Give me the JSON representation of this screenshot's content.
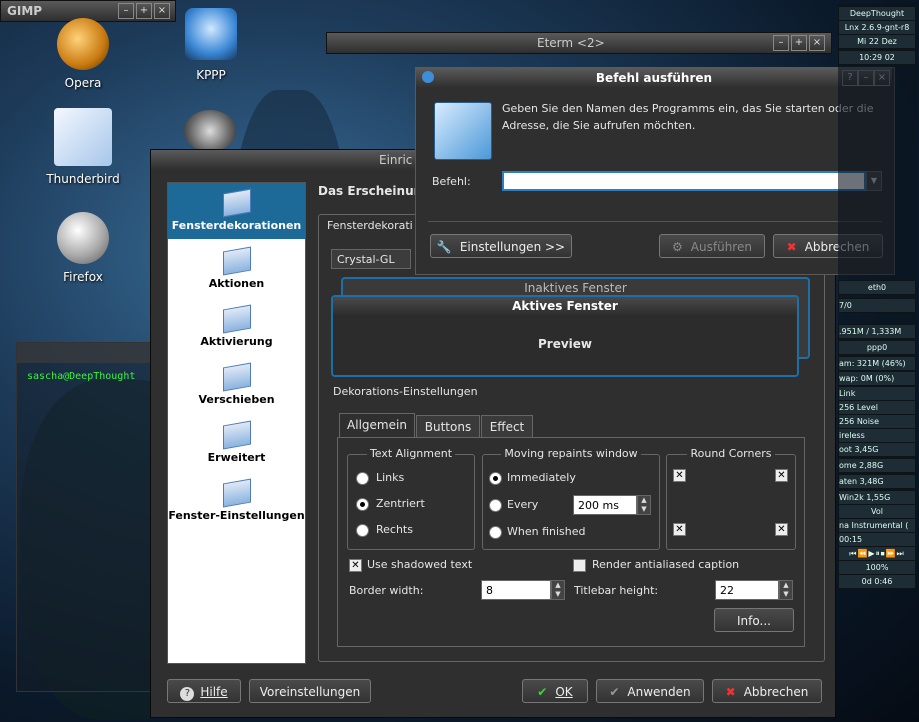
{
  "desktop": {
    "icons": [
      {
        "label": "Opera",
        "icon": "opera-icon"
      },
      {
        "label": "KPPP",
        "icon": "kppp-icon"
      },
      {
        "label": "Thunderbird",
        "icon": "thunderbird-icon"
      },
      {
        "label": "Firefox",
        "icon": "firefox-icon"
      }
    ]
  },
  "gimp": {
    "title": "GIMP"
  },
  "eterm": {
    "title": "Eterm <2>"
  },
  "terminal": {
    "prompt": "sascha@DeepThought"
  },
  "settings": {
    "title": "Einric",
    "nav": [
      "Fensterdekorationen",
      "Aktionen",
      "Aktivierung",
      "Verschieben",
      "Erweitert",
      "Fenster-Einstellungen"
    ],
    "heading": "Das Erscheinung",
    "group_label": "Fensterdekorati",
    "theme_select": "Crystal-GL",
    "preview": {
      "inactive_title": "Inaktives Fenster",
      "active_title": "Aktives Fenster",
      "label": "Preview"
    },
    "deco_label": "Dekorations-Einstellungen",
    "tabs": [
      "Allgemein",
      "Buttons",
      "Effect"
    ],
    "text_alignment": {
      "label": "Text Alignment",
      "options": [
        "Links",
        "Zentriert",
        "Rechts"
      ],
      "selected": "Zentriert"
    },
    "moving": {
      "label": "Moving repaints window",
      "options": [
        "Immediately",
        "Every",
        "When finished"
      ],
      "selected": "Immediately",
      "every_value": "200 ms"
    },
    "round_corners": {
      "label": "Round Corners"
    },
    "use_shadowed": "Use shadowed text",
    "render_antialiased": "Render antialiased caption",
    "border_width_label": "Border width:",
    "border_width_value": "8",
    "titlebar_height_label": "Titlebar height:",
    "titlebar_height_value": "22",
    "info_button": "Info...",
    "help": "Hilfe",
    "defaults": "Voreinstellungen",
    "ok": "OK",
    "apply": "Anwenden",
    "cancel": "Abbrechen"
  },
  "run_dialog": {
    "title": "Befehl ausführen",
    "description": "Geben Sie den Namen des Programms ein, das Sie starten oder die Adresse, die Sie aufrufen möchten.",
    "command_label": "Befehl:",
    "command_value": "",
    "settings_button": "Einstellungen >>",
    "execute_button": "Ausführen",
    "cancel_button": "Abbrechen"
  },
  "monitor": {
    "host": "DeepThought",
    "kernel": "Lnx 2.6.9-gnt-r8",
    "date_day": "Mi",
    "date_num": "22",
    "date_month": "Dez",
    "time": "10:29",
    "time_sec": "02",
    "eth": "eth0",
    "ppp": "ppp0",
    "net": "7/0",
    "mem": ".951M / 1,333M",
    "ram": "am: 321M (46%)",
    "swap": "wap: 0M (0%)",
    "link": "Link",
    "level": "256 Level",
    "noise": "256 Noise",
    "wireless": "ireless",
    "fs1": "oot 3,45G",
    "fs2": "ome 2,88G",
    "fs3": "aten 3,48G",
    "fs4": "Win2k 1,55G",
    "vol": "Vol",
    "track": "na Instrumental (",
    "elapsed": "00:15",
    "percent": "100%",
    "uptime": "0d 0:46"
  }
}
